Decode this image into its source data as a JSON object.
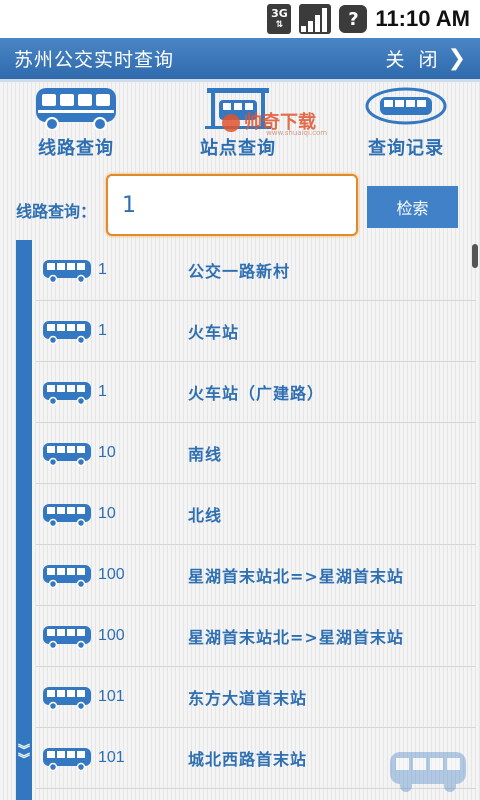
{
  "status": {
    "network": "3G",
    "help": "?",
    "time": "11:10 AM"
  },
  "titlebar": {
    "title": "苏州公交实时查询",
    "close": "关闭"
  },
  "tabs": [
    {
      "label": "线路查询",
      "icon": "bus-front-icon"
    },
    {
      "label": "站点查询",
      "icon": "bus-stop-icon"
    },
    {
      "label": "查询记录",
      "icon": "history-bus-icon"
    }
  ],
  "watermark": {
    "text": "帅奇下载",
    "sub": "www.shuaiqi.com"
  },
  "search": {
    "label": "线路查询：",
    "value": "1",
    "button": "检索"
  },
  "results": [
    {
      "route": "1",
      "name": "公交一路新村"
    },
    {
      "route": "1",
      "name": "火车站"
    },
    {
      "route": "1",
      "name": "火车站（广建路）"
    },
    {
      "route": "10",
      "name": "南线"
    },
    {
      "route": "10",
      "name": "北线"
    },
    {
      "route": "100",
      "name": "星湖首末站北=>星湖首末站"
    },
    {
      "route": "100",
      "name": "星湖首末站北=>星湖首末站"
    },
    {
      "route": "101",
      "name": "东方大道首末站"
    },
    {
      "route": "101",
      "name": "城北西路首末站"
    }
  ],
  "colors": {
    "brand_blue": "#2e6fb2",
    "titlebar": "#3a78bb",
    "input_border": "#e08a2a"
  }
}
